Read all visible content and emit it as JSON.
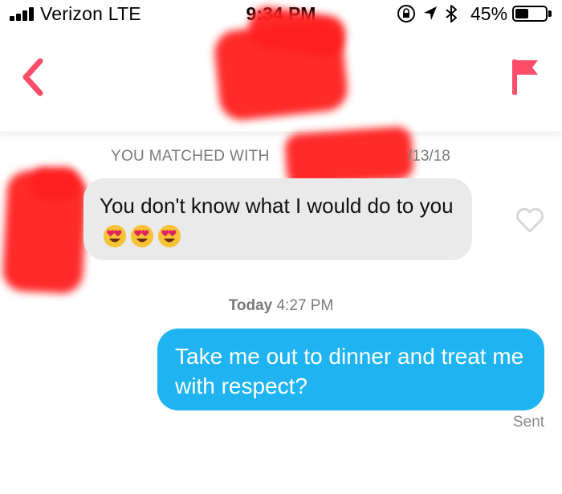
{
  "status_bar": {
    "carrier": "Verizon  LTE",
    "time": "9:34 PM",
    "battery_percent": "45%",
    "battery_level": 0.45,
    "icons": [
      "signal-bars-icon",
      "orientation-lock-icon",
      "location-arrow-icon",
      "bluetooth-icon",
      "battery-icon"
    ]
  },
  "header": {
    "back_icon": "chevron-left-icon",
    "report_icon": "flag-icon",
    "accent_color": "#fd4d69"
  },
  "conversation": {
    "match_banner": "YOU MATCHED WITH",
    "match_date": "/13/18",
    "incoming_message": "You don't know what I would do to you",
    "incoming_emoji": [
      "heart-eyes-emoji",
      "heart-eyes-emoji",
      "heart-eyes-emoji"
    ],
    "like_icon": "heart-outline-icon",
    "timestamp_day": "Today",
    "timestamp_time": "4:27 PM",
    "outgoing_message": "Take me out to dinner and treat me with respect?",
    "outgoing_status": "Sent",
    "outgoing_bubble_color": "#1fb4f1",
    "incoming_bubble_color": "#eaeaea"
  }
}
